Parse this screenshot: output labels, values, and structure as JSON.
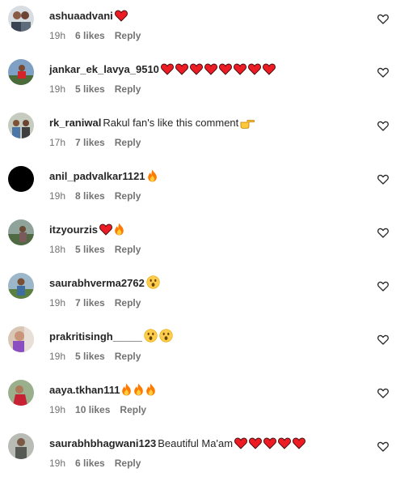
{
  "comments": [
    {
      "username": "ashuaadvani",
      "text": "",
      "emojis": [
        "heart"
      ],
      "time": "19h",
      "likes": "6 likes",
      "reply": "Reply",
      "avatar": "avatar-two-men"
    },
    {
      "username": "jankar_ek_lavya_9510",
      "text": "",
      "emojis": [
        "heart",
        "heart",
        "heart",
        "heart",
        "heart",
        "heart",
        "heart",
        "heart"
      ],
      "time": "19h",
      "likes": "5 likes",
      "reply": "Reply",
      "avatar": "avatar-person-red-shirt"
    },
    {
      "username": "rk_raniwal",
      "text": "Rakul fan's like this comment",
      "emojis": [
        "pointing-hand"
      ],
      "time": "17h",
      "likes": "7 likes",
      "reply": "Reply",
      "avatar": "avatar-group-photo"
    },
    {
      "username": "anil_padvalkar1121",
      "text": "",
      "emojis": [
        "fire"
      ],
      "time": "19h",
      "likes": "8 likes",
      "reply": "Reply",
      "avatar": "avatar-black"
    },
    {
      "username": "itzyourzis",
      "text": "",
      "emojis": [
        "heart",
        "fire"
      ],
      "time": "18h",
      "likes": "5 likes",
      "reply": "Reply",
      "avatar": "avatar-outdoor-person"
    },
    {
      "username": "saurabhverma2762",
      "text": "",
      "emojis": [
        "surprised-face"
      ],
      "time": "19h",
      "likes": "7 likes",
      "reply": "Reply",
      "avatar": "avatar-person-green"
    },
    {
      "username": "prakritisingh_____",
      "text": "",
      "emojis": [
        "surprised-face",
        "surprised-face"
      ],
      "time": "19h",
      "likes": "5 likes",
      "reply": "Reply",
      "avatar": "avatar-woman-purple"
    },
    {
      "username": "aaya.tkhan111",
      "text": "",
      "emojis": [
        "fire",
        "fire",
        "fire"
      ],
      "time": "19h",
      "likes": "10 likes",
      "reply": "Reply",
      "avatar": "avatar-woman-red"
    },
    {
      "username": "saurabhbhagwani123",
      "text": "Beautiful Ma'am",
      "emojis": [
        "heart",
        "heart",
        "heart",
        "heart",
        "heart"
      ],
      "time": "19h",
      "likes": "6 likes",
      "reply": "Reply",
      "avatar": "avatar-man-grey"
    }
  ],
  "colors": {
    "heart": "#ed1c24",
    "text": "#262626",
    "meta": "#737373",
    "fire": "#ff7a00"
  }
}
